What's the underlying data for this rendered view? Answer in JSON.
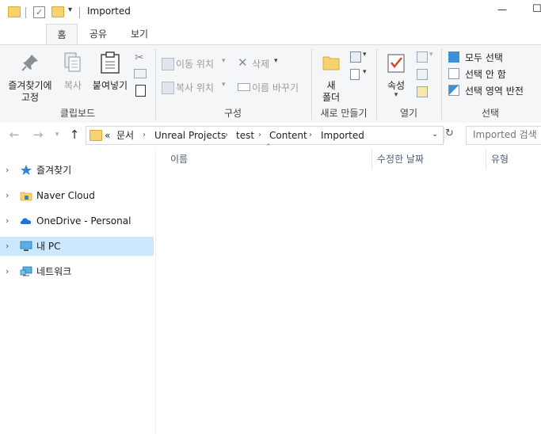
{
  "window": {
    "title": "Imported",
    "minimize_glyph": "—",
    "maximize_glyph": "☐"
  },
  "tabs": [
    {
      "label": "홈",
      "active": true
    },
    {
      "label": "공유",
      "active": false
    },
    {
      "label": "보기",
      "active": false
    }
  ],
  "ribbon": {
    "clipboard": {
      "label": "클립보드",
      "pin_label_line1": "즐겨찾기에",
      "pin_label_line2": "고정",
      "copy_label": "복사",
      "paste_label": "붙여넣기"
    },
    "organize": {
      "label": "구성",
      "move_to": "이동 위치",
      "copy_to": "복사 위치",
      "delete": "삭제",
      "rename": "이름 바꾸기"
    },
    "new": {
      "label": "새로 만들기",
      "new_folder_line1": "새",
      "new_folder_line2": "폴더"
    },
    "open": {
      "label": "열기",
      "properties": "속성"
    },
    "select": {
      "label": "선택",
      "select_all": "모두 선택",
      "select_none": "선택 안 함",
      "invert": "선택 영역 반전"
    }
  },
  "address": {
    "overflow": "«",
    "crumbs": [
      "문서",
      "Unreal Projects",
      "test",
      "Content",
      "Imported"
    ],
    "search_placeholder": "Imported 검색"
  },
  "nav_pane": [
    {
      "label": "즐겨찾기",
      "icon": "star-icon",
      "selected": false
    },
    {
      "label": "Naver Cloud",
      "icon": "naver-cloud-icon",
      "selected": false
    },
    {
      "label": "OneDrive - Personal",
      "icon": "onedrive-icon",
      "selected": false
    },
    {
      "label": "내 PC",
      "icon": "pc-icon",
      "selected": true
    },
    {
      "label": "네트워크",
      "icon": "network-icon",
      "selected": false
    }
  ],
  "columns": [
    {
      "label": "이름"
    },
    {
      "label": "수정한 날짜"
    },
    {
      "label": "유형"
    }
  ],
  "colors": {
    "selected_bg": "#cce8ff",
    "ribbon_bg": "#f5f6f7",
    "column_text": "#4c607a"
  }
}
